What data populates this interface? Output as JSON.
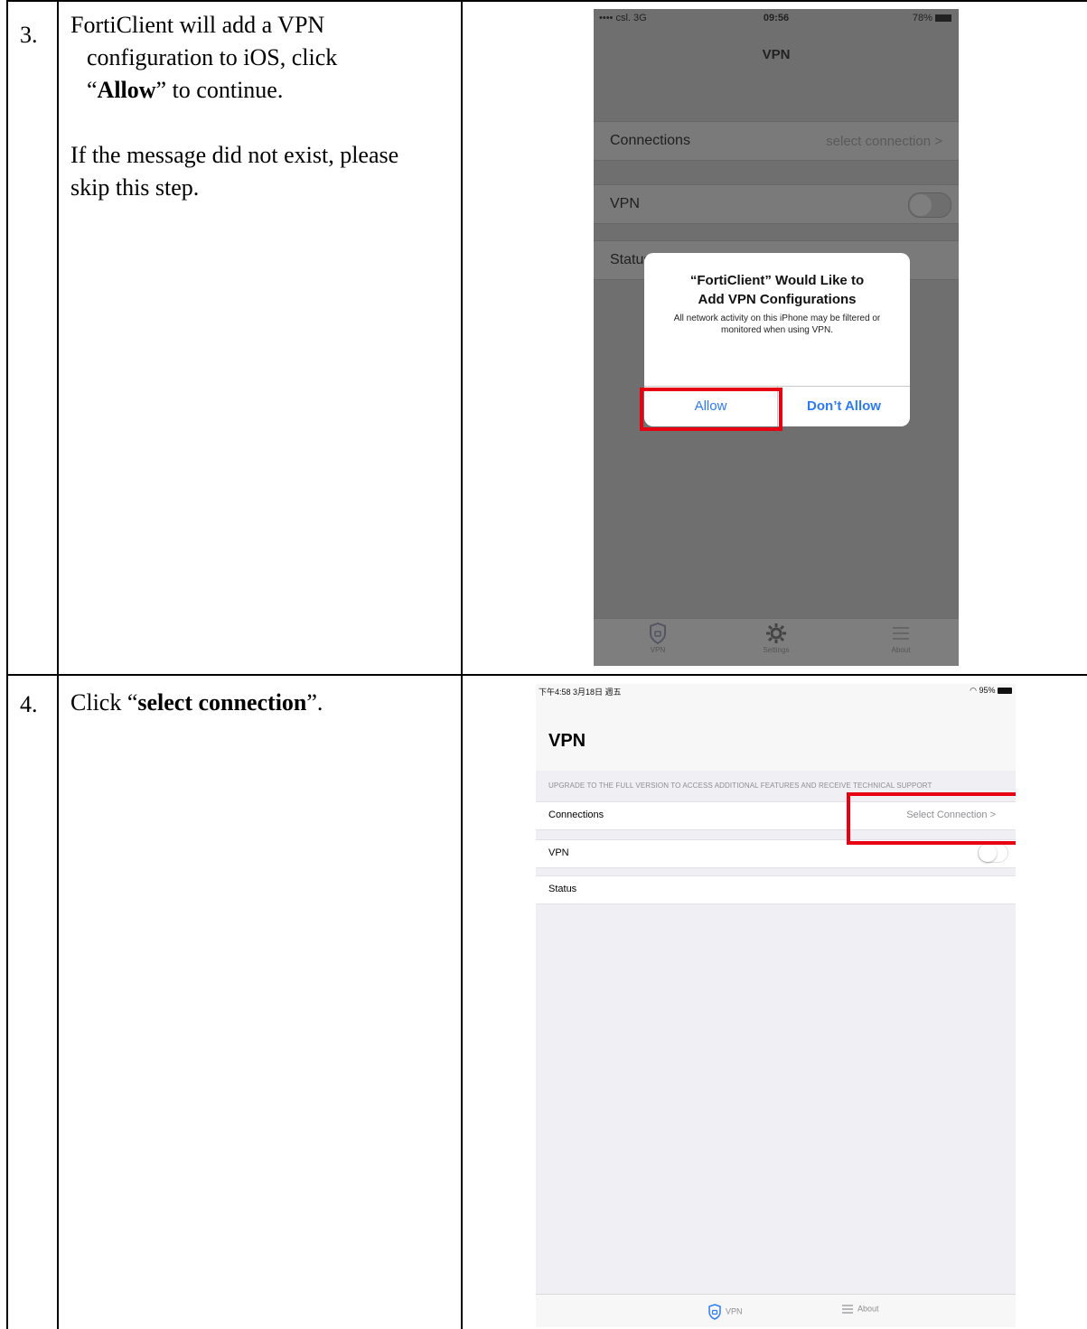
{
  "step3": {
    "number": "3.",
    "line1": "FortiClient will add a VPN",
    "line2": "configuration to iOS, click",
    "quote_open": "“",
    "emphasis": "Allow",
    "quote_close_rest": "” to continue.",
    "note_line1": "If the message did not exist, please",
    "note_line2": "skip this step.",
    "phone": {
      "status_left": "•••• csl. 3G",
      "status_time": "09:56",
      "status_right": "78%",
      "title": "VPN",
      "rows": {
        "connections_label": "Connections",
        "connections_value": "select connection >",
        "vpn_label": "VPN",
        "status_label": "Status"
      },
      "dialog": {
        "title_line1": "“FortiClient” Would Like to",
        "title_line2": "Add VPN Configurations",
        "message": "All network activity on this iPhone may be filtered or monitored when using VPN.",
        "allow": "Allow",
        "dont_allow": "Don’t Allow"
      },
      "tabs": {
        "vpn": "VPN",
        "settings": "Settings",
        "about": "About"
      }
    }
  },
  "step4": {
    "number": "4.",
    "prefix": "Click  “",
    "emphasis": "select connection",
    "suffix": "”.",
    "ipad": {
      "status_left": "下午4:58  3月18日 週五",
      "status_right": "95%",
      "title": "VPN",
      "upgrade_text": "UPGRADE TO THE FULL VERSION TO ACCESS ADDITIONAL FEATURES AND RECEIVE TECHNICAL SUPPORT",
      "rows": {
        "connections_label": "Connections",
        "connections_value": "Select Connection  >",
        "vpn_label": "VPN",
        "status_label": "Status"
      },
      "tabs": {
        "vpn": "VPN",
        "about": "About"
      }
    }
  },
  "colors": {
    "highlight": "#e60012",
    "ios_blue": "#2d7bf4"
  }
}
